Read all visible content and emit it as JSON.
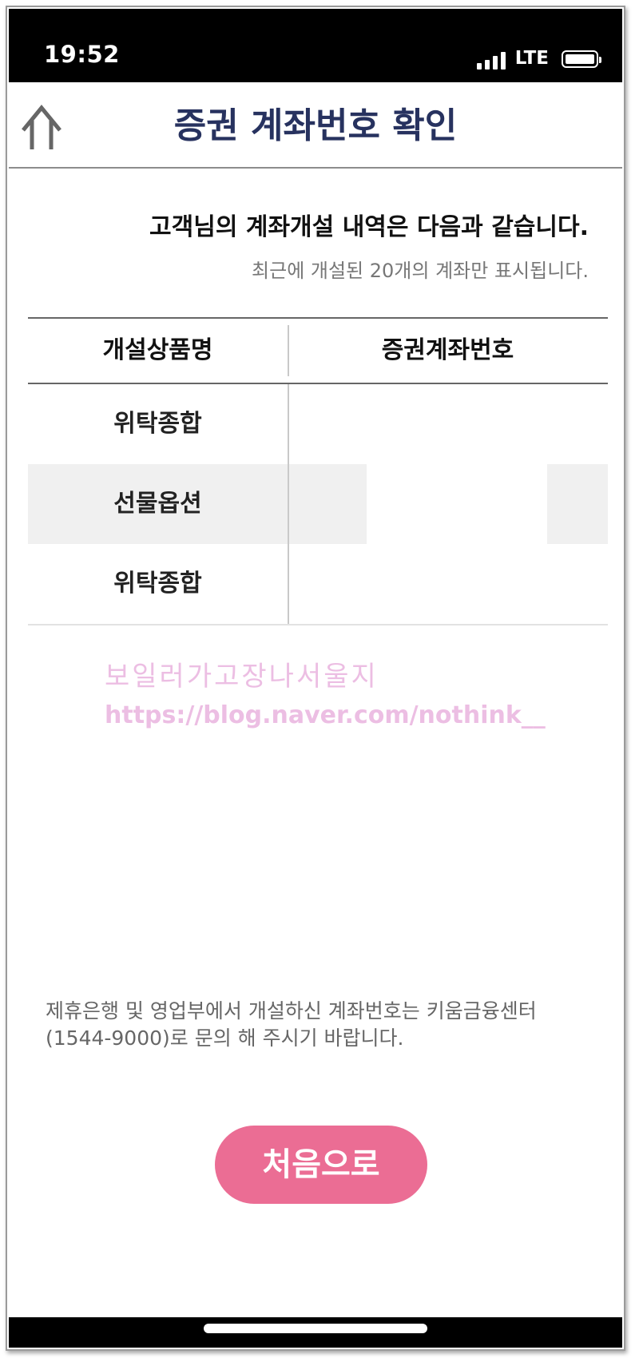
{
  "status_bar": {
    "time": "19:52",
    "network": "LTE"
  },
  "header": {
    "title": "증권 계좌번호 확인",
    "back_icon": "up-arrow-icon"
  },
  "intro": {
    "main": "고객님의 계좌개설 내역은 다음과 같습니다.",
    "sub": "최근에 개설된 20개의 계좌만 표시됩니다."
  },
  "table": {
    "headers": [
      "개설상품명",
      "증권계좌번호"
    ],
    "rows": [
      {
        "product": "위탁종합",
        "account": ""
      },
      {
        "product": "선물옵션",
        "account": ""
      },
      {
        "product": "위탁종합",
        "account": ""
      }
    ]
  },
  "watermark": {
    "line1": "보일러가고장나서울지",
    "line2": "https://blog.naver.com/nothink__"
  },
  "notice": "제휴은행 및 영업부에서 개설하신 계좌번호는 키움금융센터(1544-9000)로 문의 해 주시기 바랍니다.",
  "actions": {
    "home_label": "처음으로"
  },
  "colors": {
    "accent": "#eb6d94",
    "title": "#27325f",
    "statusbar": "#000000"
  }
}
